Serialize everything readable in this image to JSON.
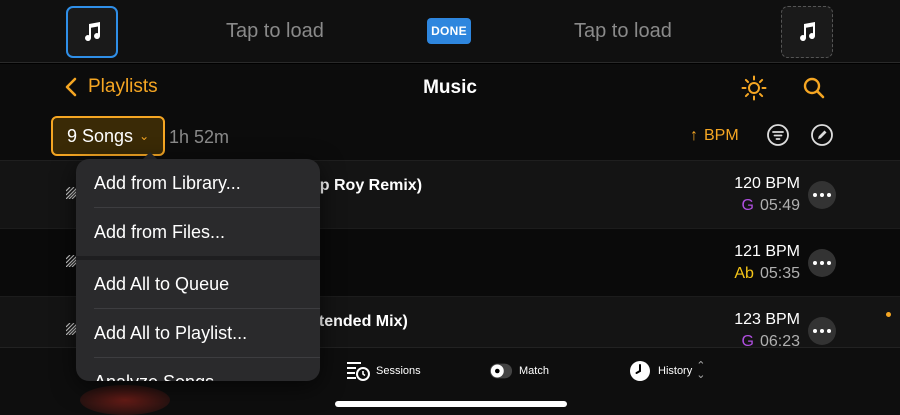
{
  "deck": {
    "left_label": "Tap to load",
    "center_badge": "DONE",
    "right_label": "Tap to load"
  },
  "nav": {
    "back_label": "Playlists",
    "title": "Music"
  },
  "toolbar": {
    "songs_label": "9 Songs",
    "duration": "1h 52m",
    "sort_label": "BPM"
  },
  "songs": [
    {
      "title_visible": "op Roy Remix)",
      "bpm": "120 BPM",
      "key": "G",
      "key_color": "#b04fe0",
      "duration": "05:49"
    },
    {
      "title_visible": "",
      "bpm": "121 BPM",
      "key": "Ab",
      "key_color": "#f5c518",
      "duration": "05:35"
    },
    {
      "title_visible": "xtended Mix)",
      "bpm": "123 BPM",
      "key": "G",
      "key_color": "#b04fe0",
      "duration": "06:23"
    }
  ],
  "menu": {
    "items": [
      "Add from Library...",
      "Add from Files...",
      "Add All to Queue",
      "Add All to Playlist...",
      "Analyze Songs"
    ]
  },
  "tabs": {
    "sessions": "Sessions",
    "match": "Match",
    "history": "History"
  },
  "colors": {
    "accent": "#f5a623",
    "deck_active_border": "#2f8fe8",
    "done_badge": "#2e86de"
  },
  "icons": {
    "deck_thumb": "music-note-icon",
    "back": "chevron-left-icon",
    "sun": "sun-icon",
    "search": "search-icon",
    "filter": "filter-icon",
    "edit": "pencil-icon",
    "more": "ellipsis-icon",
    "sessions": "sessions-icon",
    "match": "toggle-icon",
    "history": "clock-icon"
  }
}
